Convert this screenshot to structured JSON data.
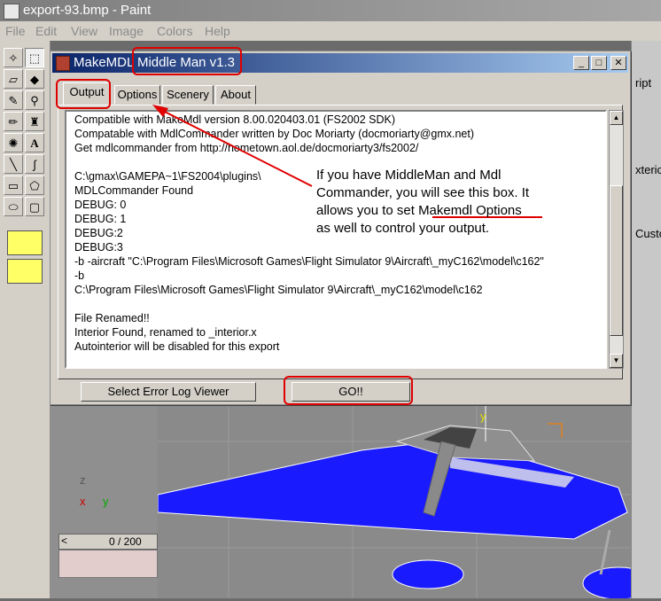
{
  "paint": {
    "title": "export-93.bmp - Paint",
    "menu": [
      "File",
      "Edit",
      "View",
      "Image",
      "Colors",
      "Help"
    ]
  },
  "dialog": {
    "app_name": "MakeMDL",
    "subtitle": "Middle Man v1.3",
    "tabs": [
      "Output",
      "Options",
      "Scenery",
      "About"
    ],
    "active_tab": "Output",
    "output_lines": [
      "Compatible with MakeMdl version 8.00.020403.01 (FS2002 SDK)",
      "Compatable with MdlCommander written by Doc Moriarty (docmoriarty@gmx.net)",
      "Get mdlcommander from http://hometown.aol.de/docmoriarty3/fs2002/",
      "",
      "C:\\gmax\\GAMEPA~1\\FS2004\\plugins\\",
      "MDLCommander Found",
      "DEBUG: 0",
      "DEBUG: 1",
      "DEBUG:2",
      "DEBUG:3",
      "-b -aircraft \"C:\\Program Files\\Microsoft Games\\Flight Simulator 9\\Aircraft\\_myC162\\model\\c162\"",
      "-b",
      "C:\\Program Files\\Microsoft Games\\Flight Simulator 9\\Aircraft\\_myC162\\model\\c162",
      "",
      "File Renamed!!",
      "Interior Found, renamed to _interior.x",
      "Autointerior will be disabled for this export"
    ],
    "buttons": {
      "error_log": "Select Error Log Viewer",
      "go": "GO!!"
    }
  },
  "annotation": {
    "line1": "If you have MiddleMan and Mdl",
    "line2": "Commander, you will see this box.  It",
    "line3_pre": "allows you to set ",
    "line3_ul": "Makemdl Options",
    "line4": "as well to control your output."
  },
  "background": {
    "right_panel": [
      "ript",
      "xteric",
      "Custo"
    ],
    "timebar": "0 / 200",
    "axis": {
      "z": "z",
      "x": "x",
      "y": "y",
      "y_main": "y"
    }
  },
  "colors": {
    "highlight": "#e00000",
    "dialog_title_start": "#0a246a",
    "dialog_title_end": "#a6caf0",
    "plane_wire": "#1a1aff"
  }
}
